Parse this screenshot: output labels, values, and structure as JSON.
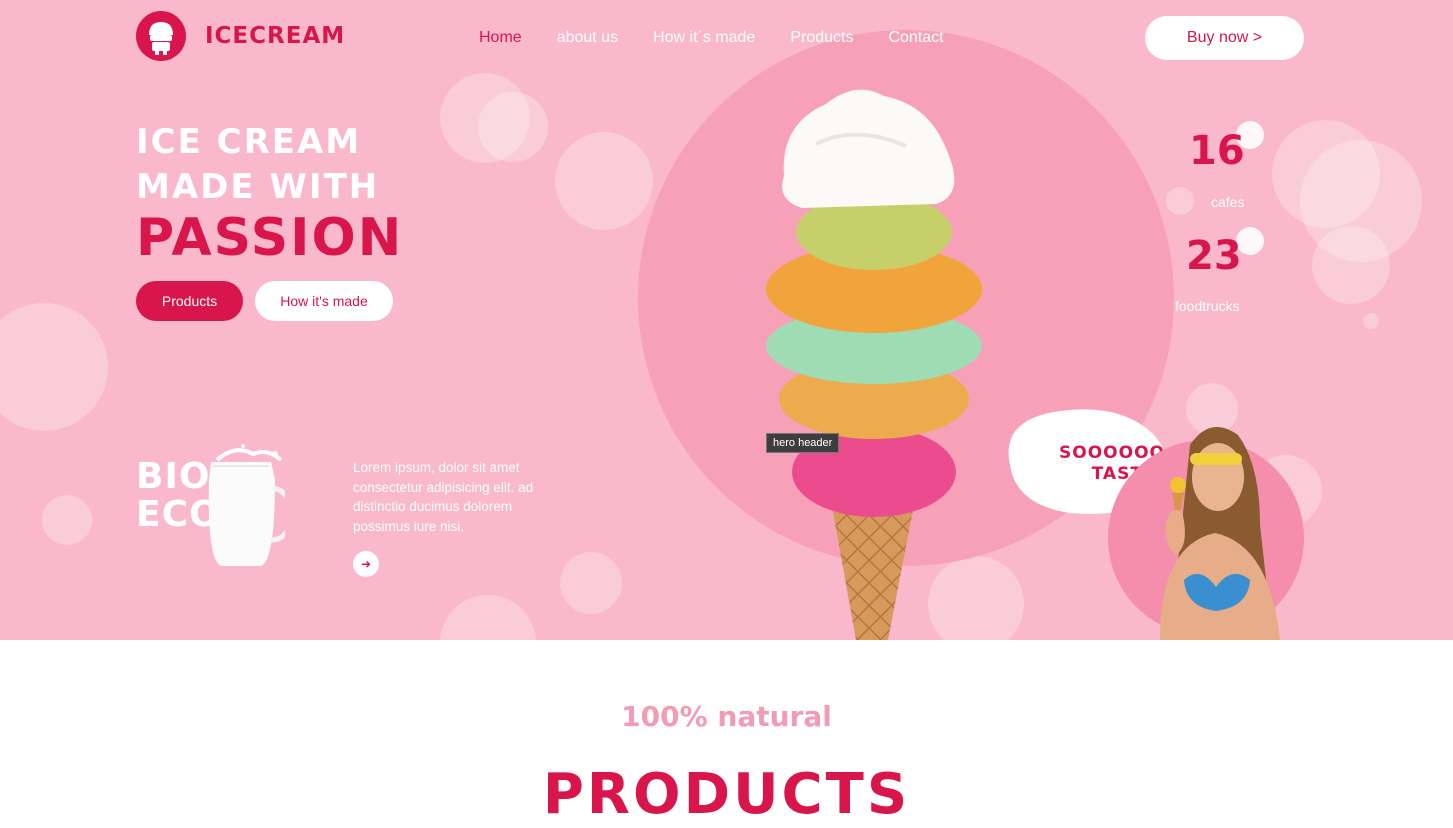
{
  "brand": {
    "name": "ICECREAM",
    "logo_icon": "ice-cream-logo-icon",
    "color": "#d8164b"
  },
  "nav": {
    "items": [
      {
        "label": "Home",
        "active": true
      },
      {
        "label": "about us",
        "active": false
      },
      {
        "label": "How it´s made",
        "active": false
      },
      {
        "label": "Products",
        "active": false
      },
      {
        "label": "Contact",
        "active": false
      }
    ],
    "buy_label": "Buy now >"
  },
  "hero": {
    "line1": "ICE CREAM",
    "line2": "MADE WITH",
    "line3": "PASSION",
    "primary_button": "Products",
    "secondary_button": "How it's made",
    "bio_line1": "BIO",
    "bio_line2": "ECO",
    "lorem": "Lorem ipsum, dolor sit amet consectetur adipisicing elit. ad distinctio ducimus dolorem possimus iure nisi.",
    "arrow_icon": "arrow-right-icon",
    "section_tag": "hero header",
    "stats": [
      {
        "value": "16",
        "label": "cafes"
      },
      {
        "value": "23",
        "label": "foodtrucks"
      }
    ],
    "speech_line1": "SOOOOOO",
    "speech_line2": "TASTY!"
  },
  "products_section": {
    "eyebrow": "100% natural",
    "title": "PRODUCTS"
  },
  "colors": {
    "hero_bg": "#f9b8cb",
    "accent": "#d8164b",
    "circle": "#f7a1b9",
    "natural": "#f29bb4"
  }
}
